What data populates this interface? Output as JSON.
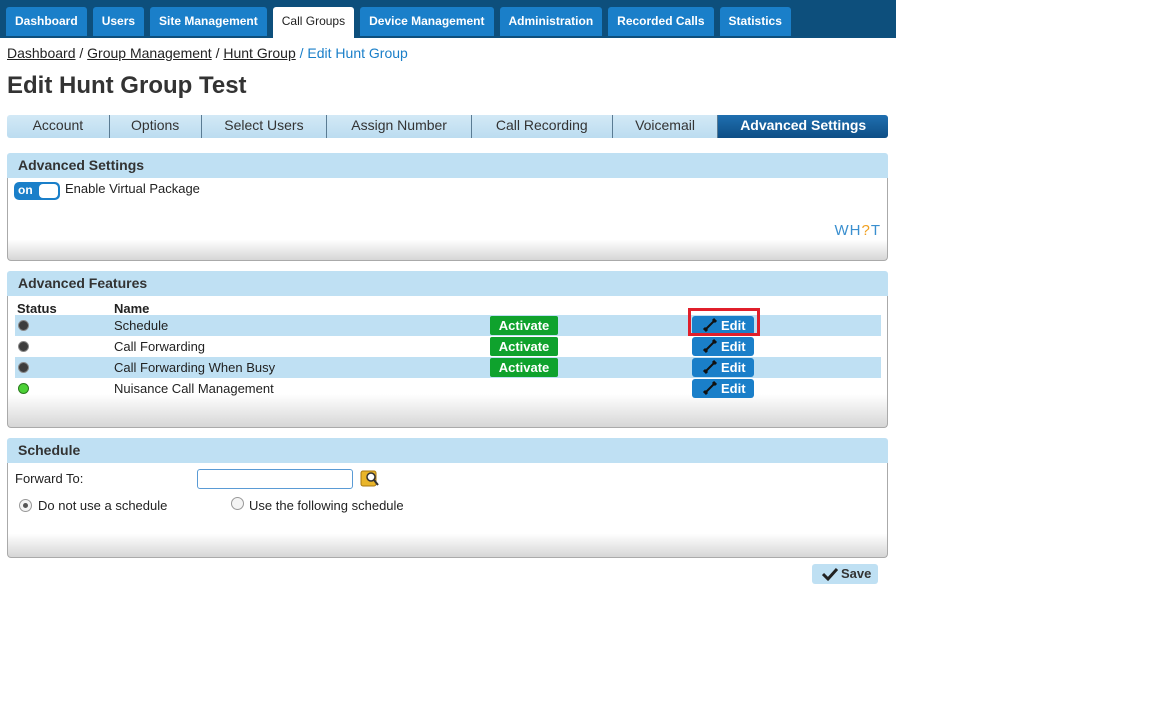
{
  "top_nav": [
    "Dashboard",
    "Users",
    "Site Management",
    "Call Groups",
    "Device Management",
    "Administration",
    "Recorded Calls",
    "Statistics"
  ],
  "top_nav_active": "Call Groups",
  "breadcrumb": {
    "items": [
      "Dashboard",
      "Group Management",
      "Hunt Group"
    ],
    "current": "Edit Hunt Group"
  },
  "page_title": "Edit Hunt Group Test",
  "sub_tabs": [
    "Account",
    "Options",
    "Select Users",
    "Assign Number",
    "Call Recording",
    "Voicemail",
    "Advanced Settings"
  ],
  "sub_tabs_active": "Advanced Settings",
  "advanced_settings": {
    "title": "Advanced Settings",
    "toggle_state": "on",
    "toggle_label": "Enable Virtual Package",
    "logo_text": {
      "a": "WH",
      "b": "?",
      "c": "T"
    }
  },
  "advanced_features": {
    "title": "Advanced Features",
    "col_status": "Status",
    "col_name": "Name",
    "activate_label": "Activate",
    "edit_label": "Edit",
    "rows": [
      {
        "name": "Schedule",
        "status": "inactive",
        "show_activate": true
      },
      {
        "name": "Call Forwarding",
        "status": "inactive",
        "show_activate": true
      },
      {
        "name": "Call Forwarding When Busy",
        "status": "inactive",
        "show_activate": true
      },
      {
        "name": "Nuisance Call Management",
        "status": "active",
        "show_activate": false
      }
    ]
  },
  "schedule": {
    "title": "Schedule",
    "forward_to_label": "Forward To:",
    "forward_to_value": "",
    "option_none": "Do not use a schedule",
    "option_use": "Use the following schedule",
    "selected": "none"
  },
  "save_label": "Save",
  "colors": {
    "nav_bg": "#0d4f7c",
    "accent": "#1a7fc9",
    "activate": "#0fa22d",
    "highlight": "#e01f2b"
  }
}
